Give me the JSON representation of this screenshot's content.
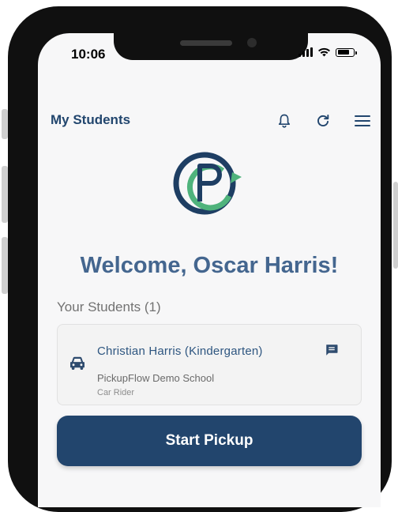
{
  "status_bar": {
    "time": "10:06"
  },
  "header": {
    "title": "My Students"
  },
  "icons": {
    "bell": "bell-icon",
    "refresh": "refresh-icon",
    "menu": "menu-icon",
    "car": "car-icon",
    "message": "message-icon"
  },
  "welcome": {
    "text": "Welcome, Oscar Harris!"
  },
  "students": {
    "section_label": "Your Students (1)",
    "items": [
      {
        "name": "Christian Harris (Kindergarten)",
        "school": "PickupFlow Demo School",
        "rider_type": "Car Rider"
      }
    ]
  },
  "actions": {
    "start_pickup_label": "Start Pickup"
  },
  "colors": {
    "primary": "#22456d",
    "title_blue": "#22466e",
    "welcome_blue": "#44668f",
    "logo_green": "#4fb37c",
    "background": "#f7f7f8"
  }
}
